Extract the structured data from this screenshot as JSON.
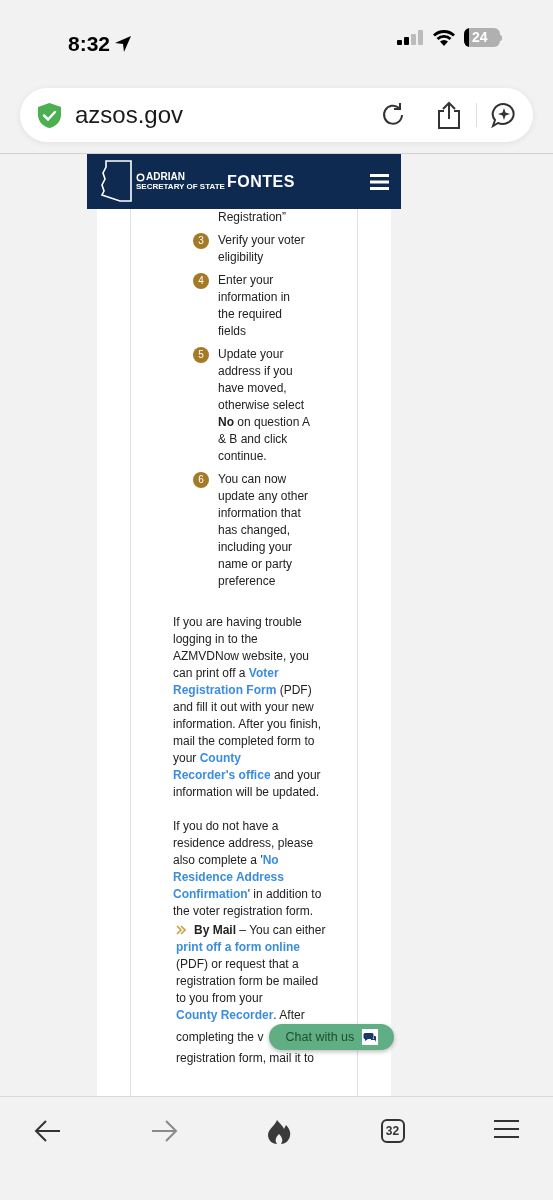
{
  "status_bar": {
    "time": "8:32",
    "battery": "24"
  },
  "address_bar": {
    "url": "azsos.gov"
  },
  "site_header": {
    "logo_name_top": "ADRIAN",
    "logo_subtitle": "SECRETARY OF STATE",
    "logo_name_main": "FONTES"
  },
  "step_continuation": "Registration”",
  "steps": [
    {
      "number": "3",
      "text": "Verify your voter eligibility"
    },
    {
      "number": "4",
      "text": "Enter your information in the required fields"
    },
    {
      "number": "5",
      "text": "Update your address if you have moved, otherwise select **No** on question A & B and click continue."
    },
    {
      "number": "6",
      "text": "You can now update any other information that has changed, including your name or party preference"
    }
  ],
  "paragraphs": [
    {
      "parts": [
        {
          "kind": "text",
          "text": "If you are having trouble logging in to the AZMVDNow website, you can print off a "
        },
        {
          "kind": "link",
          "text": "Voter"
        },
        {
          "kind": "link",
          "text": "Registration Form"
        },
        {
          "kind": "text",
          "text": " (PDF) and fill it out with your new information. After you finish, mail the completed form to your "
        },
        {
          "kind": "link",
          "text": "County"
        },
        {
          "kind": "link",
          "text": "Recorder's office"
        },
        {
          "kind": "text",
          "text": " and your information will be updated."
        }
      ]
    },
    {
      "parts": [
        {
          "kind": "text",
          "text": "If you do not have a residence address, please also complete a '"
        },
        {
          "kind": "link",
          "text": "No"
        },
        {
          "kind": "link",
          "text": "Residence Address"
        },
        {
          "kind": "link",
          "text": "Confirmation"
        },
        {
          "kind": "text",
          "text": "' in addition to the voter registration form."
        }
      ]
    }
  ],
  "by_mail": {
    "parts": [
      {
        "kind": "bold",
        "text": "By Mail"
      },
      {
        "kind": "text",
        "text": " – You can either "
      },
      {
        "kind": "link",
        "text": "print off a form"
      },
      {
        "kind": "link",
        "text": "online"
      },
      {
        "kind": "text",
        "text": " (PDF) or request that a registration form be mailed to you from your "
      },
      {
        "kind": "link",
        "text": "County Recorder"
      },
      {
        "kind": "text",
        "text": ". After"
      }
    ],
    "continued_lines": [
      "completing the v",
      "registration form, mail it to"
    ]
  },
  "chat_button": {
    "label": "Chat with us"
  },
  "toolbar": {
    "tab_count": "32",
    "forward_disabled": true
  }
}
